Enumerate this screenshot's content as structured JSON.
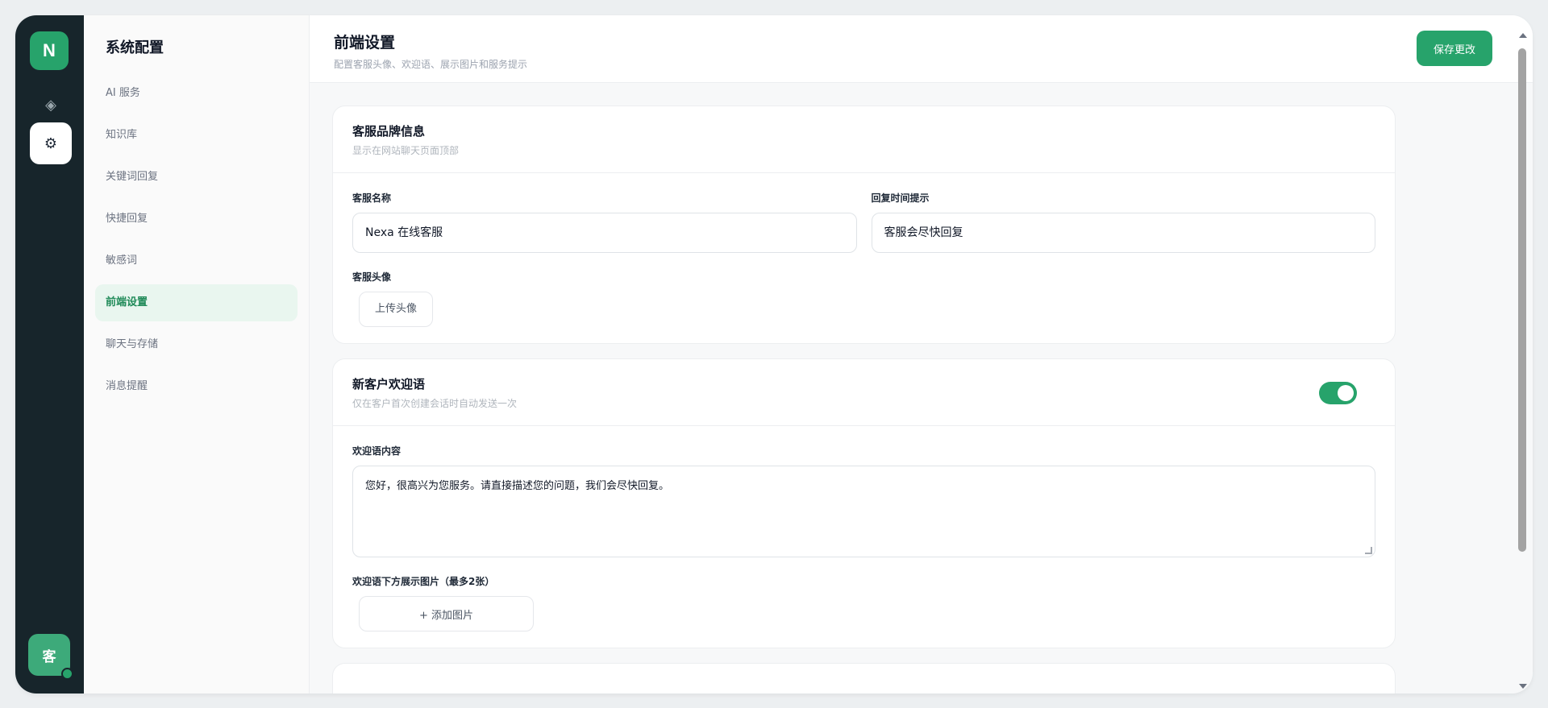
{
  "rail": {
    "logo": "N",
    "avatar": "客",
    "icons": [
      "diamond-icon",
      "gear-icon"
    ]
  },
  "sidebar": {
    "title": "系统配置",
    "items": [
      {
        "label": "AI 服务"
      },
      {
        "label": "知识库"
      },
      {
        "label": "关键词回复"
      },
      {
        "label": "快捷回复"
      },
      {
        "label": "敏感词"
      },
      {
        "label": "前端设置",
        "active": true
      },
      {
        "label": "聊天与存储"
      },
      {
        "label": "消息提醒"
      }
    ]
  },
  "header": {
    "title": "前端设置",
    "subtitle": "配置客服头像、欢迎语、展示图片和服务提示",
    "save_label": "保存更改"
  },
  "brand_card": {
    "title": "客服品牌信息",
    "desc": "显示在网站聊天页面顶部",
    "name_label": "客服名称",
    "name_value": "Nexa 在线客服",
    "reply_label": "回复时间提示",
    "reply_value": "客服会尽快回复",
    "avatar_label": "客服头像",
    "upload_label": "上传头像"
  },
  "welcome_card": {
    "title": "新客户欢迎语",
    "desc": "仅在客户首次创建会话时自动发送一次",
    "enabled": true,
    "content_label": "欢迎语内容",
    "content_value": "您好，很高兴为您服务。请直接描述您的问题，我们会尽快回复。",
    "images_label": "欢迎语下方展示图片（最多2张）",
    "add_image_label": "+ 添加图片"
  },
  "colors": {
    "accent": "#27a36b",
    "rail_bg": "#17252b",
    "active_bg": "#e9f6ef"
  }
}
